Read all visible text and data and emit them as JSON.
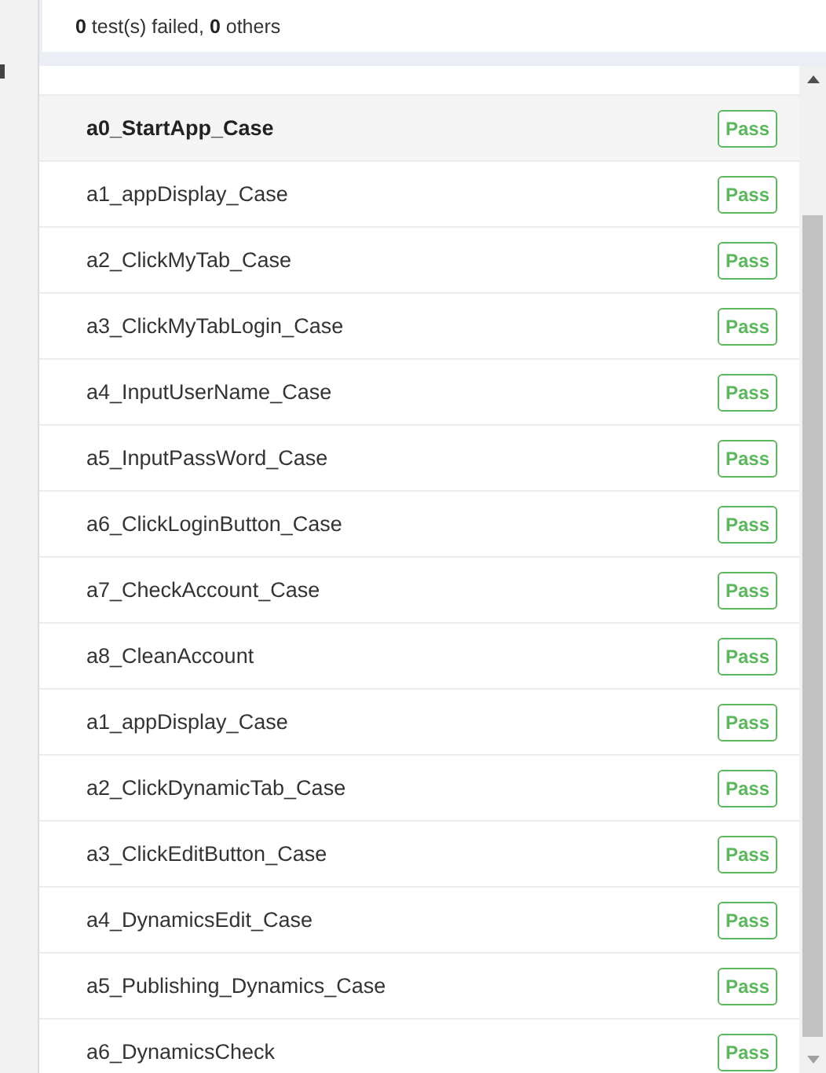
{
  "summary": {
    "failed_count": "0",
    "failed_label": "test(s) failed,",
    "others_count": "0",
    "others_label": "others"
  },
  "cases": [
    {
      "name": "a0_StartApp_Case",
      "status": "Pass",
      "selected": true
    },
    {
      "name": "a1_appDisplay_Case",
      "status": "Pass",
      "selected": false
    },
    {
      "name": "a2_ClickMyTab_Case",
      "status": "Pass",
      "selected": false
    },
    {
      "name": "a3_ClickMyTabLogin_Case",
      "status": "Pass",
      "selected": false
    },
    {
      "name": "a4_InputUserName_Case",
      "status": "Pass",
      "selected": false
    },
    {
      "name": "a5_InputPassWord_Case",
      "status": "Pass",
      "selected": false
    },
    {
      "name": "a6_ClickLoginButton_Case",
      "status": "Pass",
      "selected": false
    },
    {
      "name": "a7_CheckAccount_Case",
      "status": "Pass",
      "selected": false
    },
    {
      "name": "a8_CleanAccount",
      "status": "Pass",
      "selected": false
    },
    {
      "name": "a1_appDisplay_Case",
      "status": "Pass",
      "selected": false
    },
    {
      "name": "a2_ClickDynamicTab_Case",
      "status": "Pass",
      "selected": false
    },
    {
      "name": "a3_ClickEditButton_Case",
      "status": "Pass",
      "selected": false
    },
    {
      "name": "a4_DynamicsEdit_Case",
      "status": "Pass",
      "selected": false
    },
    {
      "name": "a5_Publishing_Dynamics_Case",
      "status": "Pass",
      "selected": false
    },
    {
      "name": "a6_DynamicsCheck",
      "status": "Pass",
      "selected": false
    }
  ]
}
